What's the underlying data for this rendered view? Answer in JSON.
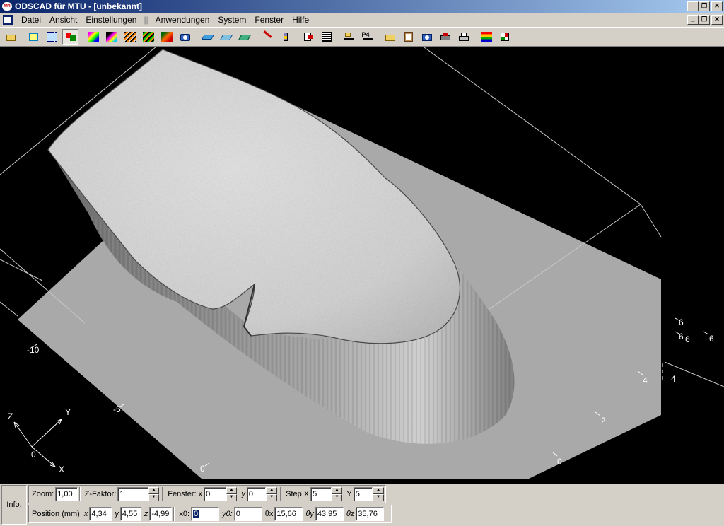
{
  "window": {
    "title": "ODSCAD für MTU - [unbekannt]",
    "app_badge": "M4"
  },
  "menu": {
    "items": [
      "Datei",
      "Ansicht",
      "Einstellungen",
      "Anwendungen",
      "System",
      "Fenster",
      "Hilfe"
    ],
    "separator": "||"
  },
  "toolbar": {
    "icons": [
      "open-folder-icon",
      "zoom-box-icon",
      "zoom-view-icon",
      "rotate-icon",
      "color-map-1-icon",
      "color-map-2-icon",
      "color-map-3-icon",
      "color-map-4-icon",
      "color-map-5-icon",
      "camera-icon",
      "plane-1-icon",
      "plane-2-icon",
      "plane-3-icon",
      "cut-icon",
      "probe-icon",
      "export-icon",
      "report-icon",
      "load-icon",
      "save-icon",
      "folder-icon",
      "clipboard-icon",
      "snapshot-icon",
      "print-preview-icon",
      "print-icon",
      "legend-icon",
      "flag-icon"
    ]
  },
  "viewport": {
    "axis_labels_front": [
      "-10",
      "-5",
      "0"
    ],
    "axis_labels_right": [
      "0",
      "2",
      "4",
      "6"
    ],
    "axis_labels_far": [
      "4",
      "6",
      "6",
      "6",
      "6"
    ],
    "triad": {
      "z": "Z",
      "y": "Y",
      "x": "X",
      "origin": "0"
    }
  },
  "status": {
    "info_label": "Info.",
    "zoom_label": "Zoom:",
    "zoom_value": "1,00",
    "zfactor_label": "Z-Faktor:",
    "zfactor_value": "1",
    "fenster_label": "Fenster: x",
    "fenster_x": "0",
    "fenster_y_label": "y",
    "fenster_y": "0",
    "stepx_label": "Step X",
    "stepx_value": "5",
    "stepy_label": "Y",
    "stepy_value": "5",
    "position_label": "Position (mm)",
    "pos_x_label": "x",
    "pos_x": "4,34",
    "pos_y_label": "y",
    "pos_y": "4,55",
    "pos_z_label": "z",
    "pos_z": "-4,99",
    "x0_label": "x0:",
    "x0_value": "0",
    "y0_label": "y0:",
    "y0_value": "0",
    "theta_x_label": "θx",
    "theta_x": "15,66",
    "theta_y_label": "θy",
    "theta_y": "43,95",
    "theta_z_label": "θz",
    "theta_z": "35,76"
  }
}
